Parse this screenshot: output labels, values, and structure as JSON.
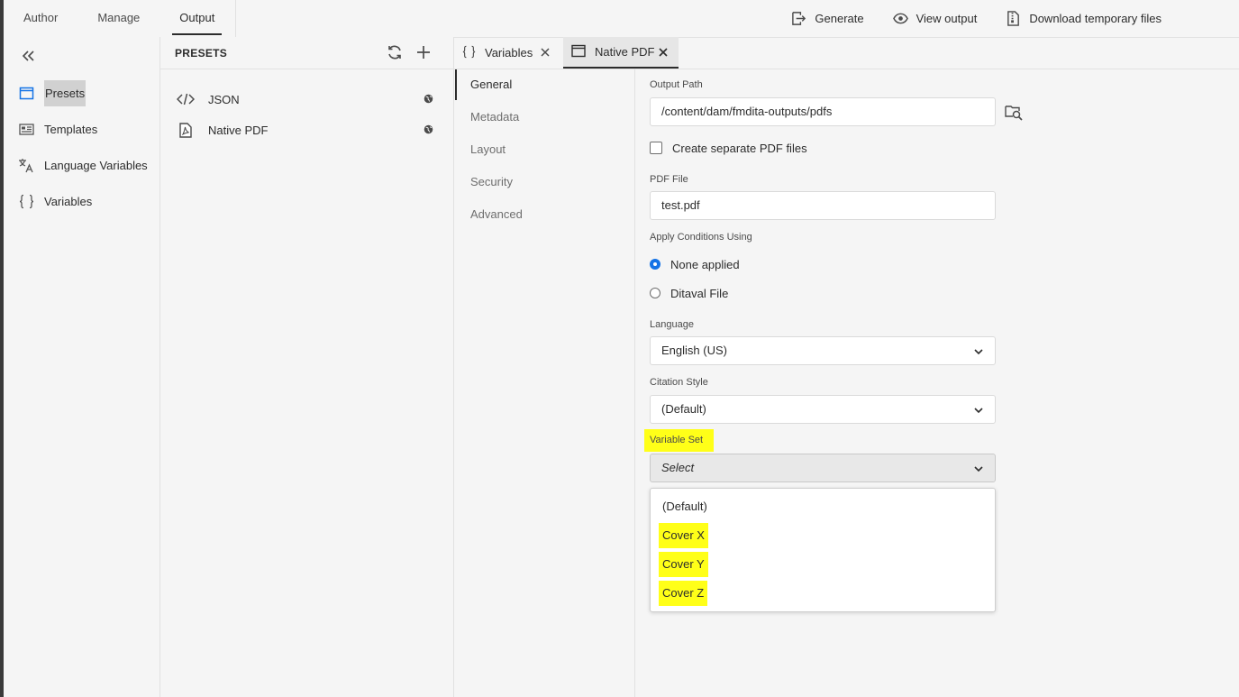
{
  "topnav": {
    "tabs": [
      "Author",
      "Manage",
      "Output"
    ],
    "active": "Output"
  },
  "actions": {
    "generate": "Generate",
    "view_output": "View output",
    "download": "Download temporary files"
  },
  "rail": {
    "items": [
      "Presets",
      "Templates",
      "Language Variables",
      "Variables"
    ],
    "active": "Presets"
  },
  "presets": {
    "title": "PRESETS",
    "items": [
      {
        "label": "JSON",
        "icon": "code-icon"
      },
      {
        "label": "Native PDF",
        "icon": "pdf-file-icon"
      }
    ]
  },
  "tabs": [
    {
      "label": "Variables",
      "icon": "braces-icon",
      "active": false
    },
    {
      "label": "Native PDF",
      "icon": "window-icon",
      "active": true
    }
  ],
  "sections": {
    "items": [
      "General",
      "Metadata",
      "Layout",
      "Security",
      "Advanced"
    ],
    "active": "General"
  },
  "form": {
    "output_path_label": "Output Path",
    "output_path_value": "/content/dam/fmdita-outputs/pdfs",
    "separate_pdf_label": "Create separate PDF files",
    "separate_pdf_checked": false,
    "pdf_file_label": "PDF File",
    "pdf_file_value": "test.pdf",
    "conditions_label": "Apply Conditions Using",
    "conditions_options": [
      "None applied",
      "Ditaval File"
    ],
    "conditions_selected": "None applied",
    "language_label": "Language",
    "language_value": "English (US)",
    "citation_label": "Citation Style",
    "citation_value": "(Default)",
    "variable_set_label": "Variable Set",
    "variable_set_value": "Select",
    "variable_set_options": [
      "(Default)",
      "Cover X",
      "Cover Y",
      "Cover Z"
    ]
  },
  "colors": {
    "accent": "#1473e6",
    "highlight": "#ffff18"
  }
}
